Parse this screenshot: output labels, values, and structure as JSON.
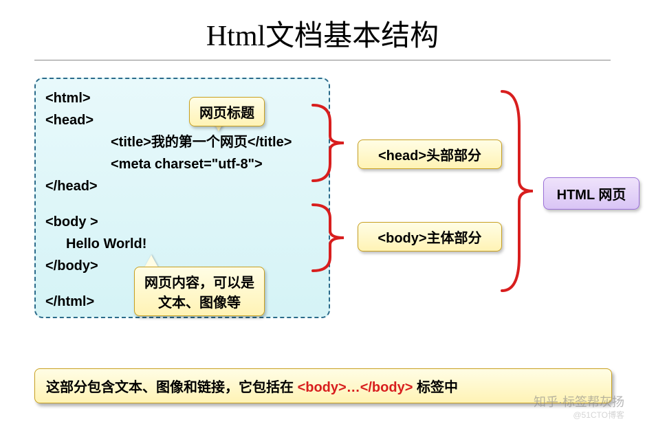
{
  "title": "Html文档基本结构",
  "code": {
    "line1": "<html>",
    "line2": "<head>",
    "line3": "<title>我的第一个网页</title>",
    "line4": "<meta charset=\"utf-8\">",
    "line5": "</head>",
    "line6": "<body >",
    "line7": "Hello World!",
    "line8": "</body>",
    "line9": "</html>"
  },
  "callouts": {
    "title": "网页标题",
    "content_l1": "网页内容，可以是",
    "content_l2": "文本、图像等"
  },
  "labels": {
    "head": "<head>头部部分",
    "body": "<body>主体部分",
    "page": "HTML 网页"
  },
  "bottom_note": {
    "prefix": "这部分包含文本、图像和链接，它包括在 ",
    "tag": "<body>…</body>",
    "suffix": " 标签中"
  },
  "watermark": "知乎·标签帮灰扬",
  "watermark2": "@51CTO博客"
}
